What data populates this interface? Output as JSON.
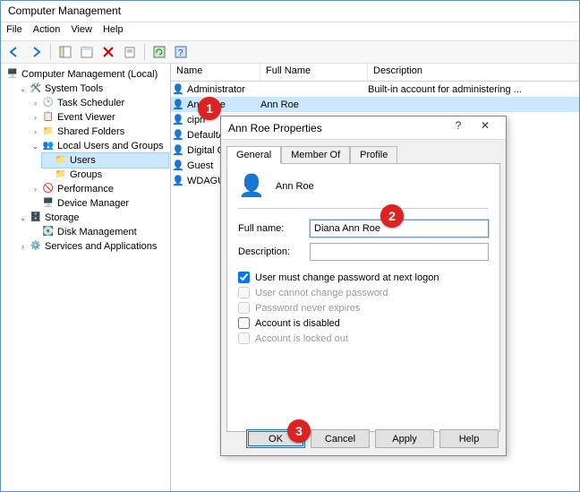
{
  "window": {
    "title": "Computer Management"
  },
  "menu": {
    "file": "File",
    "action": "Action",
    "view": "View",
    "help": "Help"
  },
  "tree": {
    "root": "Computer Management (Local)",
    "system_tools": "System Tools",
    "task_sched": "Task Scheduler",
    "event_viewer": "Event Viewer",
    "shared_folders": "Shared Folders",
    "lug": "Local Users and Groups",
    "users": "Users",
    "groups": "Groups",
    "performance": "Performance",
    "device_mgr": "Device Manager",
    "storage": "Storage",
    "disk_mgmt": "Disk Management",
    "services_apps": "Services and Applications"
  },
  "list": {
    "col_name": "Name",
    "col_full": "Full Name",
    "col_desc": "Description",
    "rows": [
      {
        "name": "Administrator",
        "full": "",
        "desc": "Built-in account for administering ..."
      },
      {
        "name": "Ann Roe",
        "full": "Ann Roe",
        "desc": ""
      },
      {
        "name": "cipri",
        "full": "",
        "desc": ""
      },
      {
        "name": "DefaultAcco...",
        "full": "",
        "desc": ""
      },
      {
        "name": "Digital Citizen",
        "full": "",
        "desc": ""
      },
      {
        "name": "Guest",
        "full": "",
        "desc": ""
      },
      {
        "name": "WDAGUtility...",
        "full": "",
        "desc": ""
      }
    ]
  },
  "dialog": {
    "title": "Ann Roe Properties",
    "tabs": {
      "general": "General",
      "member_of": "Member Of",
      "profile": "Profile"
    },
    "header_name": "Ann Roe",
    "fullname_label": "Full name:",
    "fullname_value": "Diana Ann Roe",
    "description_label": "Description:",
    "description_value": "",
    "checks": {
      "must_change": "User must change password at next logon",
      "cannot_change": "User cannot change password",
      "never_expires": "Password never expires",
      "disabled": "Account is disabled",
      "locked": "Account is locked out"
    },
    "buttons": {
      "ok": "OK",
      "cancel": "Cancel",
      "apply": "Apply",
      "help": "Help"
    }
  },
  "callouts": {
    "c1": "1",
    "c2": "2",
    "c3": "3"
  }
}
